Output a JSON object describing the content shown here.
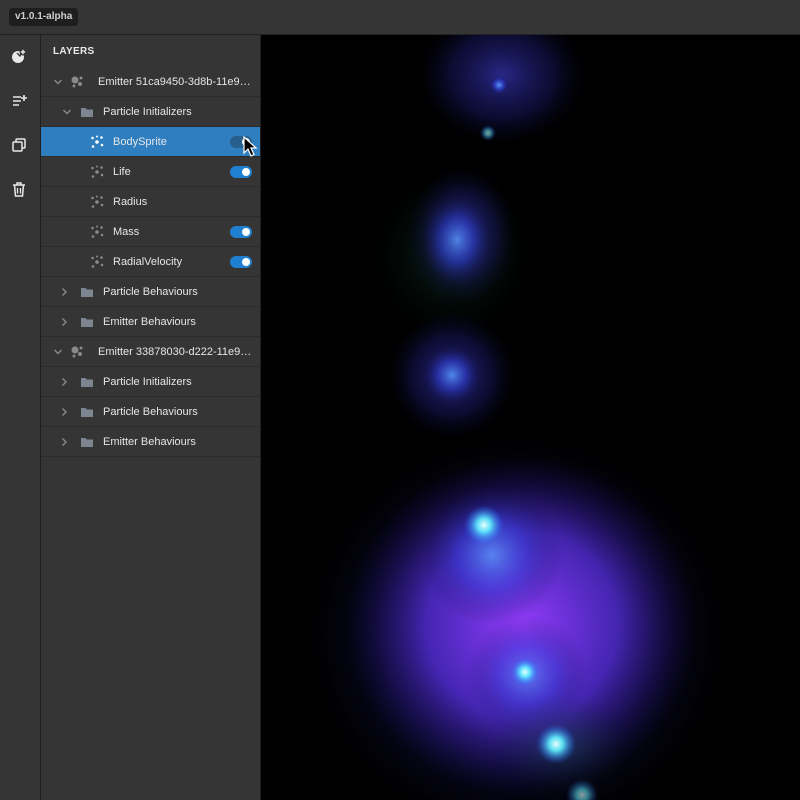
{
  "app": {
    "version": "v1.0.1-alpha"
  },
  "toolbar": {
    "items": [
      {
        "icon": "add-emitter-icon"
      },
      {
        "icon": "add-layer-icon"
      },
      {
        "icon": "duplicate-icon"
      },
      {
        "icon": "delete-icon"
      }
    ]
  },
  "layers": {
    "title": "LAYERS",
    "emitter1": {
      "label": "Emitter 51ca9450-3d8b-11e9-a1...",
      "initializers": {
        "label": "Particle Initializers",
        "items": [
          {
            "label": "BodySprite",
            "enabled": true,
            "selected": true
          },
          {
            "label": "Life",
            "enabled": true
          },
          {
            "label": "Radius",
            "enabled": false
          },
          {
            "label": "Mass",
            "enabled": true
          },
          {
            "label": "RadialVelocity",
            "enabled": true
          }
        ]
      },
      "behaviours": {
        "label": "Particle Behaviours"
      },
      "emitter_behaviours": {
        "label": "Emitter Behaviours"
      }
    },
    "emitter2": {
      "label": "Emitter 33878030-d222-11e9-bd...",
      "initializers": {
        "label": "Particle Initializers"
      },
      "behaviours": {
        "label": "Particle Behaviours"
      },
      "emitter_behaviours": {
        "label": "Emitter Behaviours"
      }
    }
  },
  "colors": {
    "panel_bg": "#353535",
    "selected_row": "#2f7fc0",
    "toggle_on": "#1f7fd0",
    "canvas_bg": "#000000"
  }
}
